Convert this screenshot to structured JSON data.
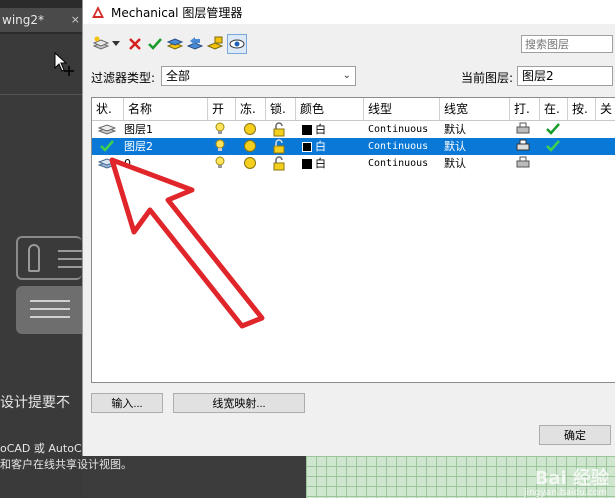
{
  "background": {
    "tab_title": "wing2*",
    "tab_close": "×",
    "text_line1": "设计提要不",
    "text_line2": "oCAD 或 AutoC",
    "text_line3": "和客户在线共享设计视图。",
    "watermark": "Bai 经验",
    "watermark_sub": "jingyan.baidu.com"
  },
  "dialog": {
    "title": "Mechanical 图层管理器",
    "search_placeholder": "搜索图层",
    "filter_label": "过滤器类型:",
    "filter_value": "全部",
    "current_label": "当前图层:",
    "current_value": "图层2",
    "columns": [
      "状.",
      "名称",
      "开",
      "冻.",
      "锁.",
      "颜色",
      "线型",
      "线宽",
      "打.",
      "在.",
      "按.",
      "关"
    ],
    "rows": [
      {
        "name": "图层1",
        "color": "白",
        "linetype": "Continuous",
        "lineweight": "默认",
        "current": false,
        "selected": false
      },
      {
        "name": "图层2",
        "color": "白",
        "linetype": "Continuous",
        "lineweight": "默认",
        "current": true,
        "selected": true
      },
      {
        "name": "0",
        "color": "白",
        "linetype": "Continuous",
        "lineweight": "默认",
        "current": false,
        "selected": false
      }
    ],
    "buttons": {
      "import": "输入...",
      "lineweight_map": "线宽映射...",
      "ok": "确定"
    }
  },
  "colors": {
    "selection": "#0a78d7",
    "annotation_arrow": "#e0262b",
    "check_green": "#1a9c2a"
  }
}
